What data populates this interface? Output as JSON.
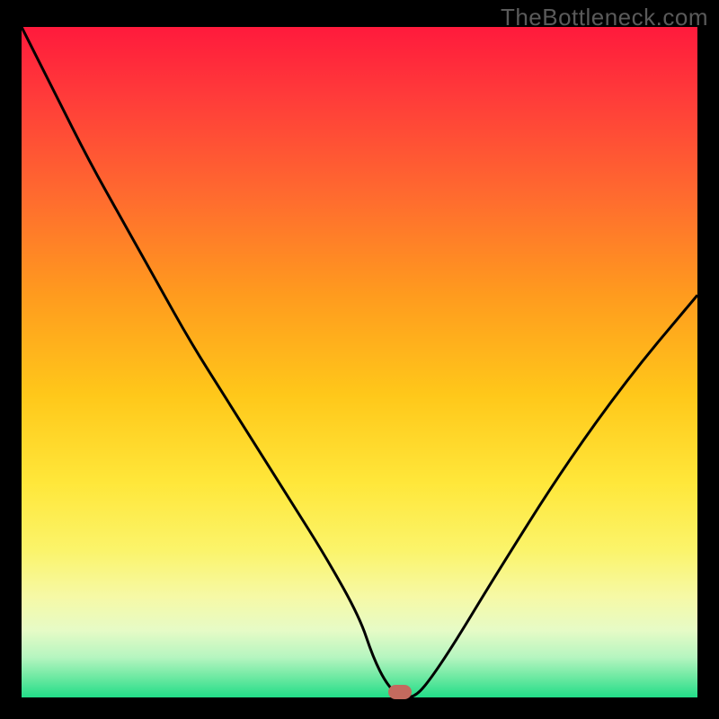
{
  "watermark": "TheBottleneck.com",
  "chart_data": {
    "type": "line",
    "title": "",
    "xlabel": "",
    "ylabel": "",
    "xlim": [
      0,
      100
    ],
    "ylim": [
      0,
      100
    ],
    "grid": false,
    "legend": false,
    "background_gradient": {
      "top_color": "#ff1a3c",
      "mid_color": "#ffe73a",
      "bottom_color": "#22dd88"
    },
    "series": [
      {
        "name": "bottleneck-curve",
        "color": "#000000",
        "x": [
          0,
          5,
          10,
          15,
          20,
          25,
          30,
          35,
          40,
          45,
          50,
          52,
          54,
          56,
          58,
          60,
          64,
          70,
          80,
          90,
          100
        ],
        "y": [
          100,
          90,
          80,
          71,
          62,
          53,
          45,
          37,
          29,
          21,
          12,
          6,
          2,
          0,
          0,
          2,
          8,
          18,
          34,
          48,
          60
        ]
      }
    ],
    "marker": {
      "name": "optimal-point",
      "x": 56,
      "y": 0,
      "color": "#c36a5e"
    }
  }
}
